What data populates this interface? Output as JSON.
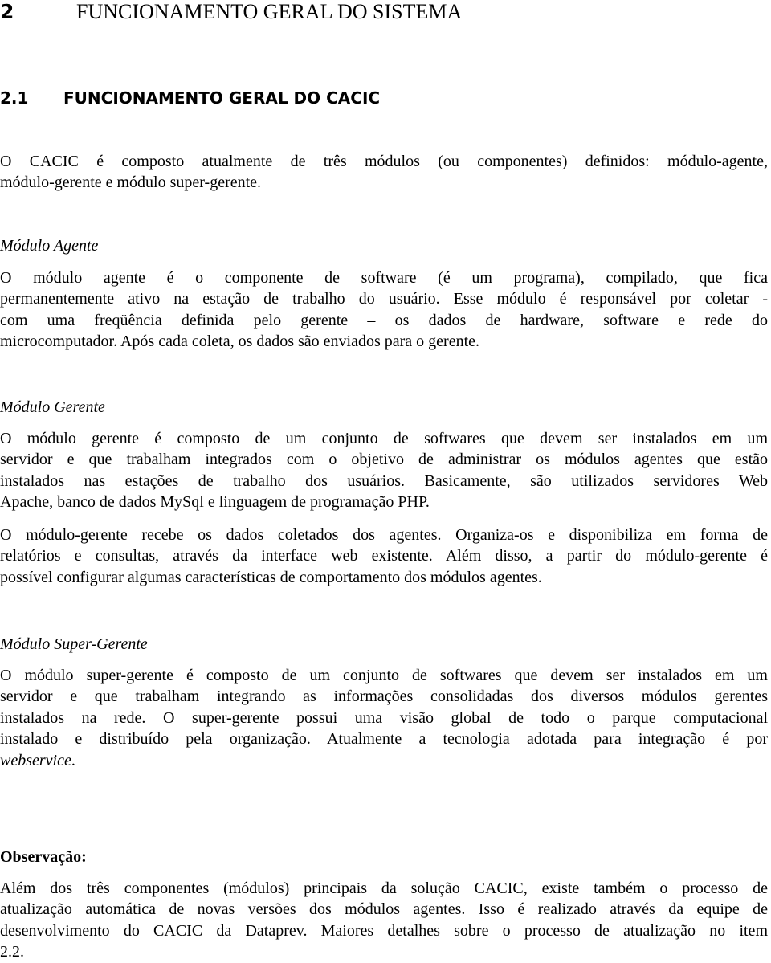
{
  "heading1": {
    "number": "2",
    "title": "FUNCIONAMENTO GERAL DO SISTEMA"
  },
  "heading2": {
    "number": "2.1",
    "title": "FUNCIONAMENTO GERAL DO CACIC"
  },
  "intro": {
    "lines": [
      "O CACIC é composto atualmente de três módulos (ou componentes) definidos: módulo-agente,",
      "módulo-gerente e módulo super-gerente."
    ]
  },
  "agente": {
    "title": "Módulo Agente",
    "lines": [
      "O módulo agente é o componente de software (é um programa), compilado, que fica",
      "permanentemente ativo na estação de trabalho do usuário. Esse módulo é responsável por coletar -",
      "com uma freqüência definida pelo gerente – os dados de hardware, software e rede do",
      "microcomputador. Após cada coleta, os dados são enviados para o gerente."
    ]
  },
  "gerente": {
    "title": "Módulo Gerente",
    "paragraph1": [
      "O módulo gerente é composto de um conjunto de softwares que devem ser instalados em um",
      "servidor e que trabalham integrados com o objetivo de administrar os módulos agentes que estão",
      "instalados nas estações de trabalho dos usuários. Basicamente, são utilizados servidores Web",
      "Apache, banco de dados MySql e linguagem de programação PHP."
    ],
    "paragraph2": [
      "O módulo-gerente recebe os dados coletados dos agentes. Organiza-os e disponibiliza em forma de",
      "relatórios e consultas, através da interface web existente. Além disso, a partir do módulo-gerente é",
      "possível configurar algumas características de comportamento dos módulos agentes."
    ]
  },
  "supergerente": {
    "title": "Módulo Super-Gerente",
    "lines": [
      "O módulo super-gerente é composto de um conjunto de softwares que devem ser instalados em um",
      "servidor e que trabalham integrando as informações consolidadas dos diversos módulos gerentes",
      "instalados na rede. O super-gerente possui uma visão global de todo o parque computacional",
      "instalado e distribuído pela organização. Atualmente a tecnologia adotada para integração é por"
    ],
    "last_line_italic": "webservice",
    "last_line_suffix": "."
  },
  "observacao": {
    "title": "Observação:",
    "lines": [
      "Além dos três componentes (módulos) principais da solução CACIC, existe também o processo de",
      "atualização automática de novas versões dos módulos agentes. Isso é realizado através da equipe de",
      "desenvolvimento do CACIC da Dataprev. Maiores detalhes sobre o processo de atualização no item",
      "2.2."
    ]
  }
}
